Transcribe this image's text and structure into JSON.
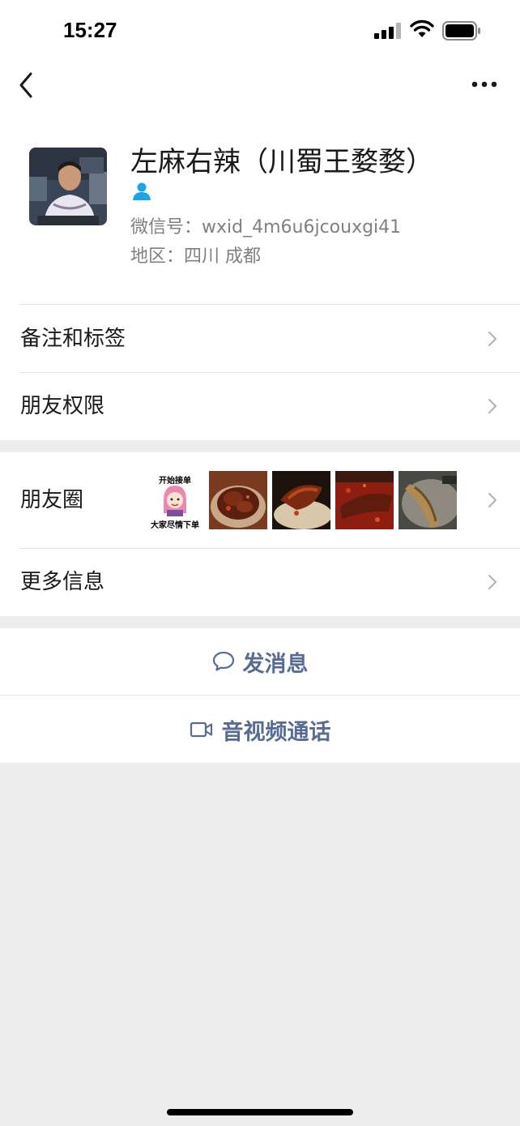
{
  "status_bar": {
    "time": "15:27"
  },
  "nav": {
    "back_icon": "chevron-left-icon",
    "more_icon": "ellipsis-icon"
  },
  "profile": {
    "nickname": "左麻右辣（川蜀王婺婺）",
    "wechat_id": "微信号：wxid_4m6u6jcouxgi41",
    "region": "地区：四川 成都",
    "badge_icon": "person-icon",
    "badge_color": "#1aa5e8"
  },
  "rows": {
    "notes_tags": "备注和标签",
    "friend_permissions": "朋友权限",
    "moments": "朋友圈",
    "more_info": "更多信息"
  },
  "moments_thumbs": {
    "first_top": "开始接单",
    "first_bottom": "大家尽情下单"
  },
  "actions": {
    "send_message": "发消息",
    "video_call": "音视频通话"
  },
  "colors": {
    "link_blue": "#576b95",
    "page_bg": "#ededed",
    "secondary_text": "#808080"
  }
}
